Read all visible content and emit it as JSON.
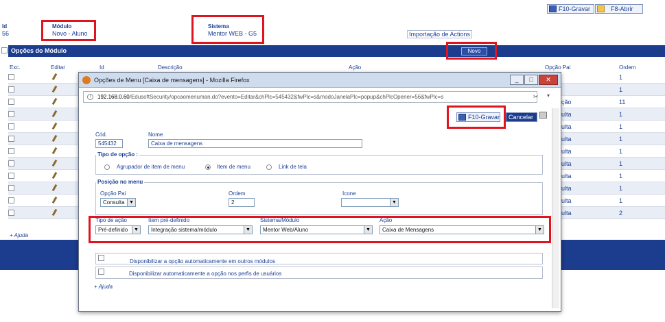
{
  "toolbar": {
    "save": "F10-Gravar",
    "open": "F8-Abrir"
  },
  "header": {
    "id_label": "Id",
    "id_value": "56",
    "modulo_label": "Módulo",
    "modulo_value": "Novo - Aluno",
    "sistema_label": "Sistema",
    "sistema_value": "Mentor WEB - G5",
    "import_link": "Importação de Actions"
  },
  "section": {
    "title": "Opções do Módulo",
    "novo": "Novo"
  },
  "columns": [
    "Exc.",
    "Editar",
    "Id",
    "Descrição",
    "Ação",
    "Opção Pai",
    "Ordem"
  ],
  "rows": [
    {
      "pai": "",
      "ordem": "1"
    },
    {
      "pai": "",
      "ordem": "1"
    },
    {
      "pai": "ção",
      "ordem": "11"
    },
    {
      "pai": "ulta",
      "ordem": "1"
    },
    {
      "pai": "ulta",
      "ordem": "1"
    },
    {
      "pai": "ulta",
      "ordem": "1"
    },
    {
      "pai": "ulta",
      "ordem": "1"
    },
    {
      "pai": "ulta",
      "ordem": "1"
    },
    {
      "pai": "ulta",
      "ordem": "1"
    },
    {
      "pai": "ulta",
      "ordem": "1"
    },
    {
      "pai": "ulta",
      "ordem": "1"
    },
    {
      "pai": "ulta",
      "ordem": "2"
    }
  ],
  "help": "+ Ajuda",
  "popup": {
    "title": "Opções de Menu [Caixa de mensagens] - Mozilla Firefox",
    "url_host": "192.168.0.60",
    "url_path": "/EdusoftSecurity/opcaomenuman.do?evento=Editar&chPlc=545432&fwPlc=s&modoJanelaPlc=popup&chPlcOpener=56&fwPlc=s",
    "save": "F10-Gravar",
    "cancel": "Cancelar",
    "cod_label": "Cód.",
    "cod_value": "545432",
    "nome_label": "Nome",
    "nome_value": "Caixa de mensagens",
    "tipo_legend": "Tipo de opção :",
    "tipo_options": [
      "Agrupador de item de menu",
      "Item de menu",
      "Link de tela"
    ],
    "posicao_legend": "Posição no menu",
    "pai_label": "Opção Pai",
    "pai_value": "Consulta",
    "ordem_label": "Ordem",
    "ordem_value": "2",
    "icone_label": "Icone",
    "icone_value": "",
    "tipo_acao_label": "Tipo de ação",
    "tipo_acao_value": "Pré-definido",
    "item_label": "Item pré-definido",
    "item_value": "Integração sistema/módulo",
    "sistema_label": "Sistema/Módulo",
    "sistema_value": "Mentor Web/Aluno",
    "acao_label": "Ação",
    "acao_value": "Caixa de Mensagens",
    "check1": "Disponibilizar a opção automaticamente em outros módulos",
    "check2": "Disponibilizar automaticamente a opção nos perfis de usuários",
    "help": "+ Ajuda"
  }
}
